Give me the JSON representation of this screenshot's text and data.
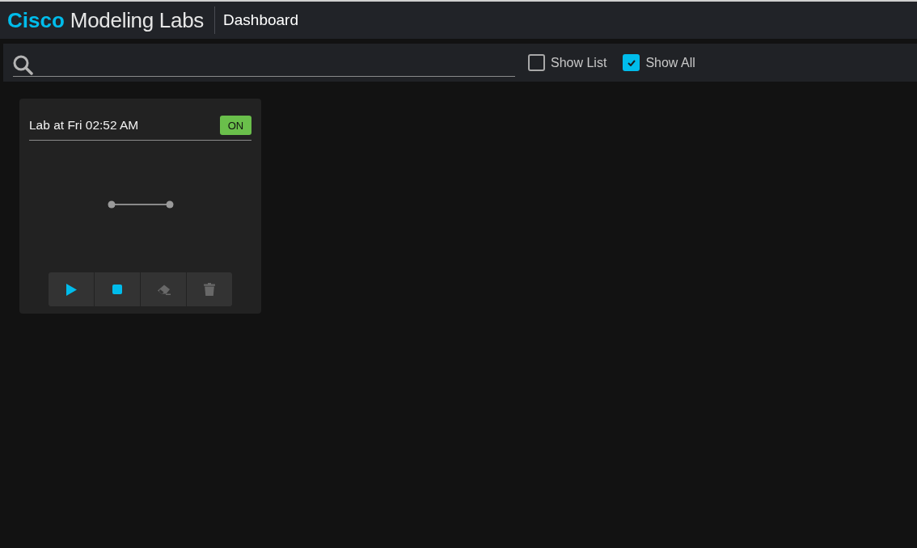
{
  "header": {
    "brand": "Cisco",
    "product": "Modeling Labs",
    "page": "Dashboard"
  },
  "filters": [
    {
      "label": "Show List",
      "checked": false
    },
    {
      "label": "Show All",
      "checked": true
    }
  ],
  "labs": [
    {
      "title": "Lab at Fri 02:52 AM",
      "status": "ON",
      "actions": [
        {
          "kind": "start",
          "disabled": false
        },
        {
          "kind": "stop",
          "disabled": false
        },
        {
          "kind": "wipe",
          "disabled": true
        },
        {
          "kind": "delete",
          "disabled": true
        }
      ]
    }
  ]
}
